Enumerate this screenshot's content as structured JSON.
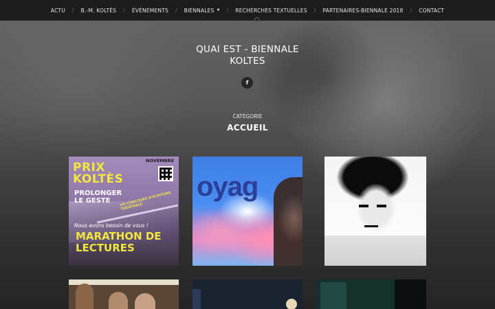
{
  "nav": {
    "items": [
      {
        "label": "ACTU",
        "has_dropdown": false
      },
      {
        "label": "B.-M. KOLTÈS",
        "has_dropdown": false
      },
      {
        "label": "ÉVÈNEMENTS",
        "has_dropdown": false
      },
      {
        "label": "BIENNALES",
        "has_dropdown": true
      },
      {
        "label": "RECHERCHES TEXTUELLES",
        "has_dropdown": false
      },
      {
        "label": "PARTENAIRES-BIENNALE 2018",
        "has_dropdown": false
      },
      {
        "label": "CONTACT",
        "has_dropdown": false
      }
    ],
    "separator": "/",
    "caret": "▼",
    "search_icon": "search-icon"
  },
  "site": {
    "title": "QUAI EST - BIENNALE KOLTES",
    "social_icon": "facebook-icon",
    "social_glyph": "f"
  },
  "archive": {
    "label": "CATEGORIE",
    "title": "ACCUEIL"
  },
  "posts": [
    {
      "month": "NOVEMBRE",
      "headline": "PRIX KOLTÈS",
      "sub": "PROLONGER LE GESTE",
      "banner": "UN CONCOURS D'ÉCRITURE THÉÂTRALE",
      "tagline": "Nous avons besoin de vous !",
      "main": "MARATHON DE LECTURES"
    },
    {
      "word": "oyag"
    },
    {},
    {},
    {},
    {}
  ],
  "colors": {
    "nav_bg": "#1d1d1d",
    "poster_yellow": "#f2e73a",
    "poster_purple": "#8d78a6",
    "poster_blue": "#3d7ee4",
    "poster_pink": "#f39ac0"
  }
}
